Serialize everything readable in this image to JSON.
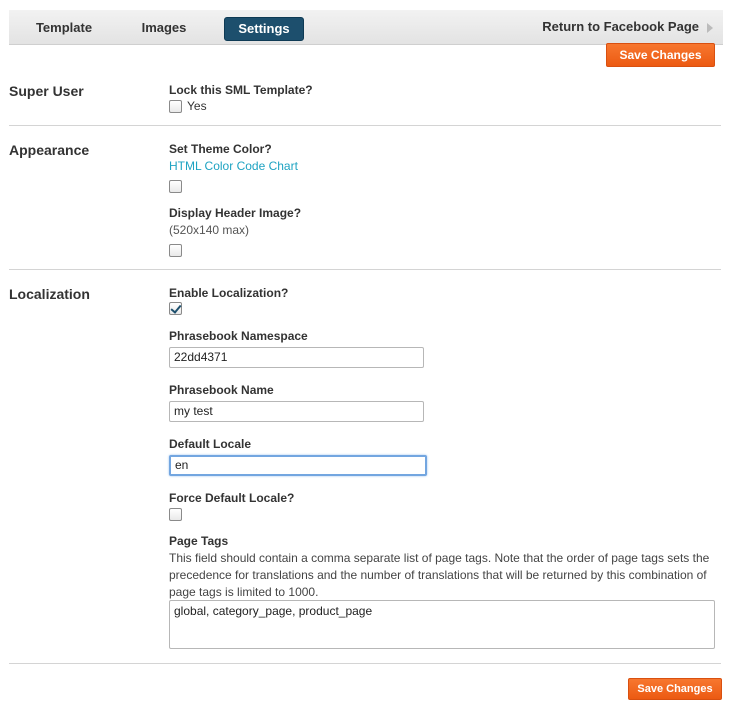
{
  "nav": {
    "tabs": [
      {
        "label": "Template"
      },
      {
        "label": "Images"
      },
      {
        "label": "Settings"
      }
    ],
    "return_label": "Return to Facebook Page"
  },
  "actions": {
    "save_top": "Save Changes",
    "save_bottom": "Save Changes"
  },
  "super_user": {
    "title": "Super User",
    "lock_label": "Lock this SML Template?",
    "lock_option": "Yes",
    "lock_checked": false
  },
  "appearance": {
    "title": "Appearance",
    "theme_label": "Set Theme Color?",
    "theme_link": "HTML Color Code Chart",
    "theme_checked": false,
    "header_label": "Display Header Image?",
    "header_hint": "(520x140 max)",
    "header_checked": false
  },
  "localization": {
    "title": "Localization",
    "enable_label": "Enable Localization?",
    "enable_checked": true,
    "namespace_label": "Phrasebook Namespace",
    "namespace_value": "22dd4371",
    "name_label": "Phrasebook Name",
    "name_value": "my test",
    "locale_label": "Default Locale",
    "locale_value": "en",
    "force_label": "Force Default Locale?",
    "force_checked": false,
    "tags_label": "Page Tags",
    "tags_help": "This field should contain a comma separate list of page tags. Note that the order of page tags sets the precedence for translations and the number of translations that will be returned by this combination of page tags is limited to 1000.",
    "tags_value": "global, category_page, product_page"
  },
  "colors": {
    "accent_orange": "#f26a21",
    "tab_active": "#1d4f6d",
    "link": "#1ea3c2"
  }
}
